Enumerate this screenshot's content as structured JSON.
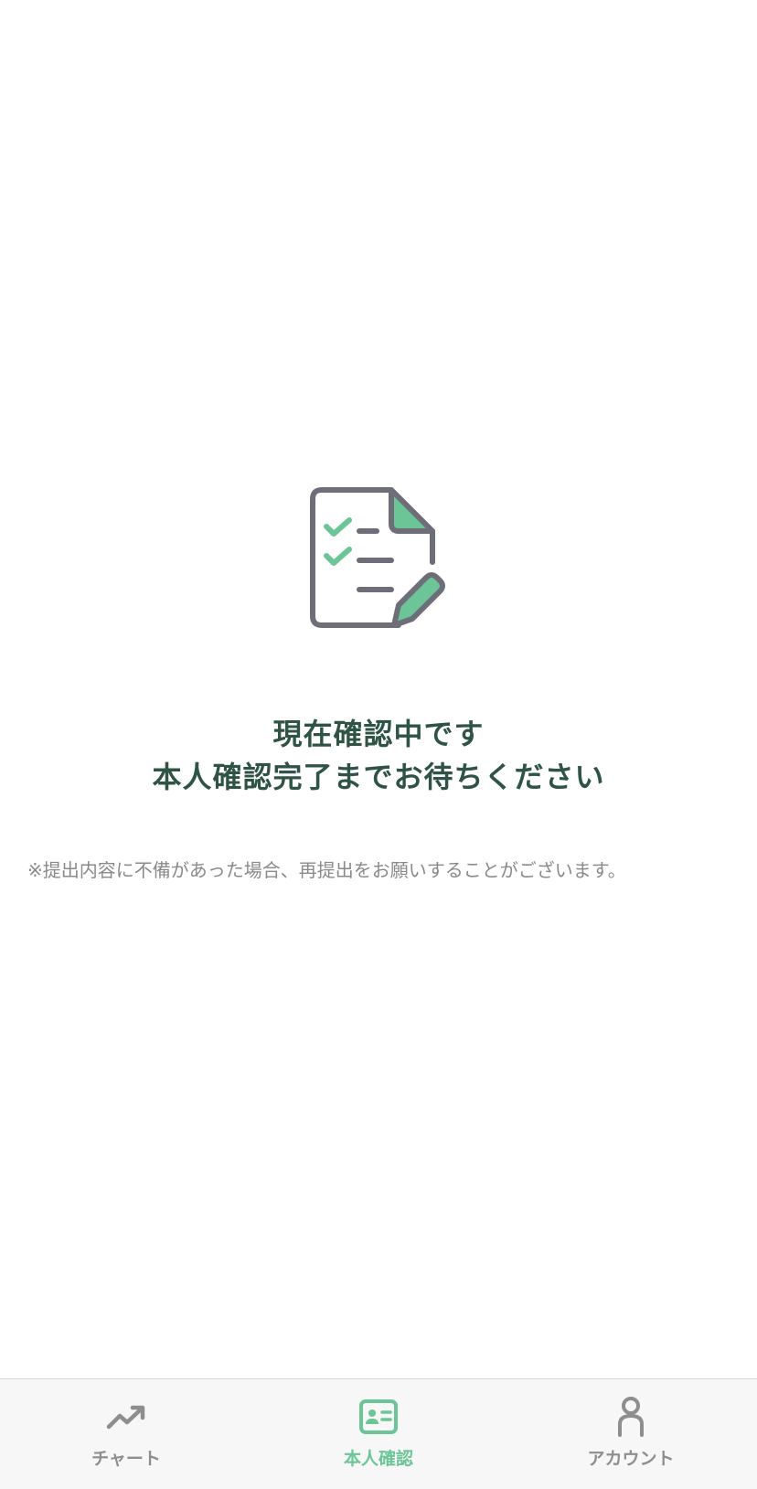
{
  "status": {
    "line1": "現在確認中です",
    "line2": "本人確認完了までお待ちください"
  },
  "note": "※提出内容に不備があった場合、再提出をお願いすることがございます。",
  "illustration": {
    "icon": "document-checklist-pencil-icon"
  },
  "tabs": [
    {
      "label": "チャート",
      "icon": "trending-up-icon",
      "active": false
    },
    {
      "label": "本人確認",
      "icon": "id-card-icon",
      "active": true
    },
    {
      "label": "アカウント",
      "icon": "person-icon",
      "active": false
    }
  ],
  "colors": {
    "accent": "#6cc596",
    "title": "#2f5446",
    "icon_gray": "#6e6e78",
    "inactive_tab": "#8e8e8e",
    "note": "#8a8a8a"
  }
}
